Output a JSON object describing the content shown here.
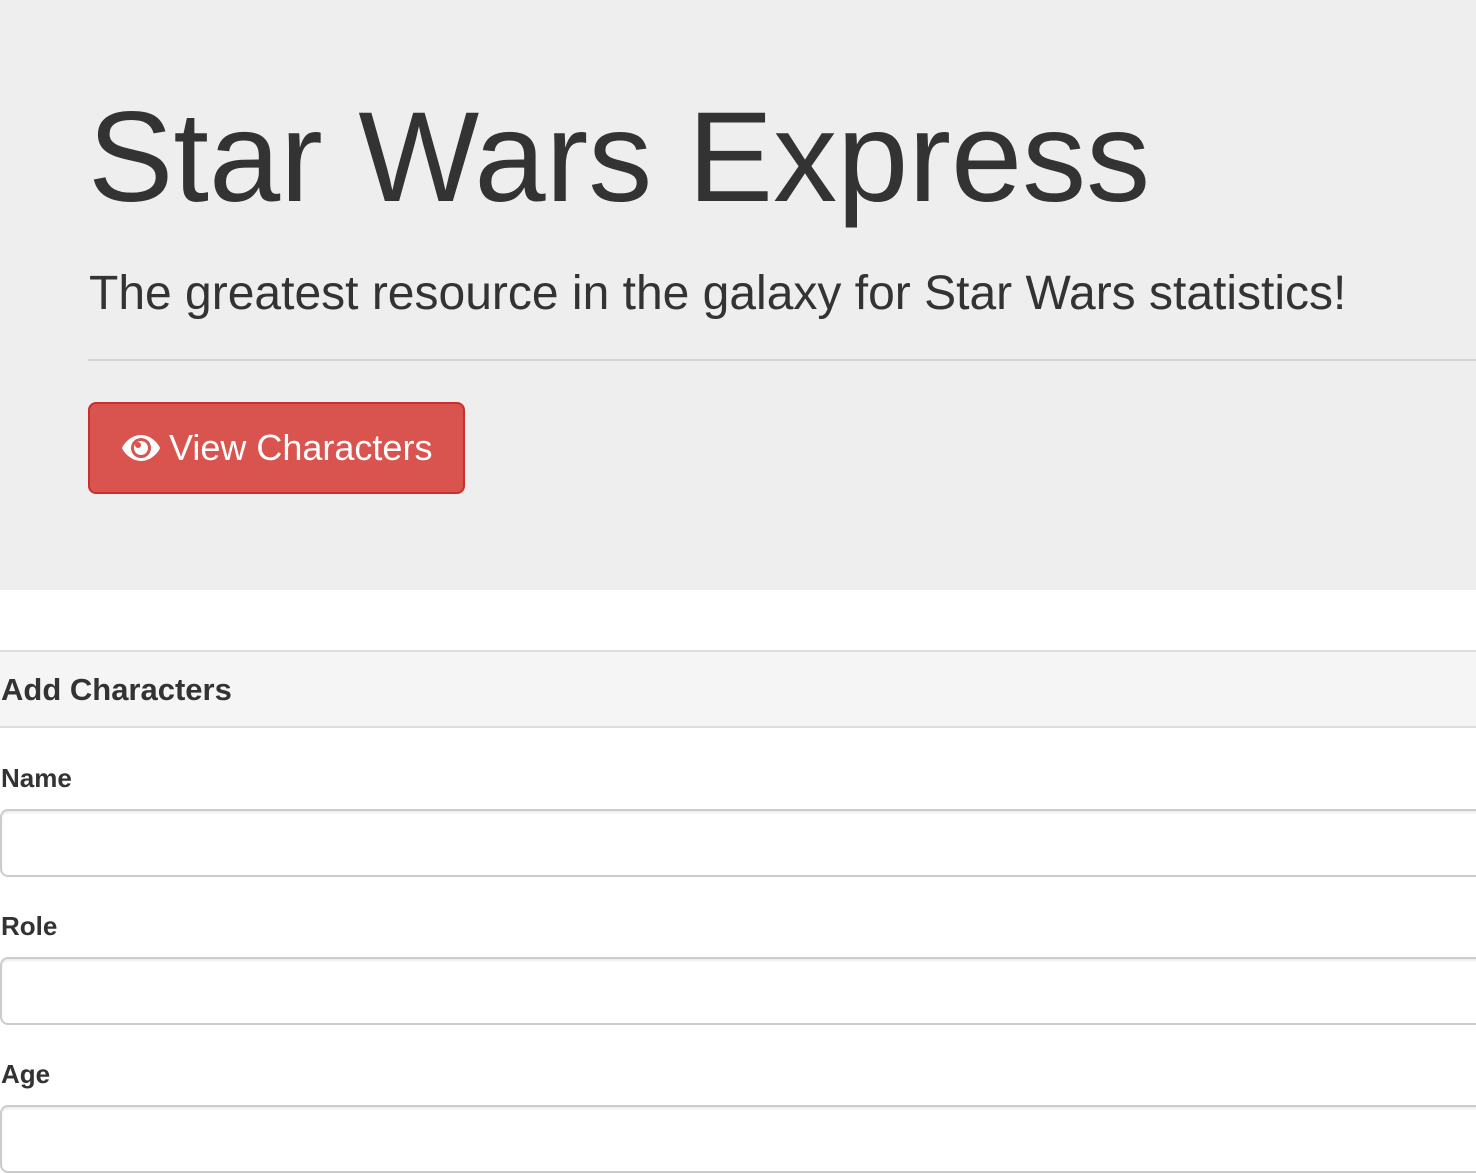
{
  "jumbotron": {
    "title": "Star Wars Express",
    "lead": "The greatest resource in the galaxy for Star Wars statistics!",
    "button": {
      "label": "View Characters",
      "icon": "eye-icon",
      "color": "#d9534f"
    }
  },
  "form_panel": {
    "heading": "Add Characters",
    "fields": [
      {
        "label": "Name",
        "value": "",
        "placeholder": ""
      },
      {
        "label": "Role",
        "value": "",
        "placeholder": ""
      },
      {
        "label": "Age",
        "value": "",
        "placeholder": ""
      }
    ]
  },
  "colors": {
    "jumbotron_bg": "#eeeeee",
    "panel_heading_bg": "#f5f5f5",
    "text": "#333333"
  }
}
